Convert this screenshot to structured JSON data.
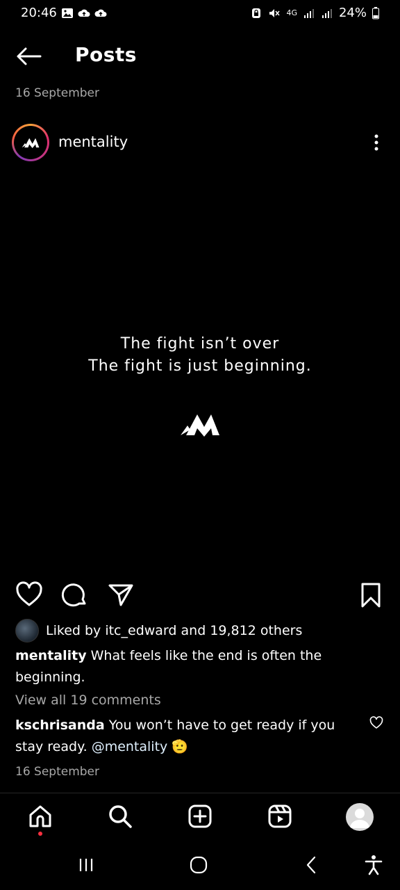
{
  "status_bar": {
    "time": "20:46",
    "network": "4G",
    "battery": "24%"
  },
  "header": {
    "title": "Posts"
  },
  "post": {
    "date_top": "16 September",
    "username": "mentality",
    "quote_line1": "The fight isn’t over",
    "quote_line2": "The fight is just beginning.",
    "likes_prefix": "Liked by ",
    "liked_by_user": "itc_edward",
    "likes_mid": " and ",
    "likes_count": "19,812 others",
    "caption_user": "mentality",
    "caption_text": " What feels like the end is often the beginning.",
    "view_comments": "View all 19 comments",
    "comment_user": "kschrisanda",
    "comment_text": " You won’t have to get ready if you stay ready. ",
    "comment_mention": "@mentality",
    "comment_emoji": "🫡",
    "date_bottom": "16 September"
  },
  "icons": {
    "status_left": [
      "gallery-icon",
      "cloud-upload-icon",
      "cloud-upload-icon"
    ],
    "status_right": [
      "vpn-icon",
      "mute-icon",
      "signal-icon",
      "signal-icon",
      "battery-icon"
    ],
    "actions": [
      "heart-icon",
      "comment-icon",
      "share-icon",
      "bookmark-icon"
    ],
    "bottom_nav": [
      "home-icon",
      "search-icon",
      "create-icon",
      "reels-icon",
      "profile-avatar"
    ],
    "system_nav": [
      "recents-icon",
      "home-circle-icon",
      "back-chevron-icon",
      "accessibility-icon"
    ]
  },
  "colors": {
    "background": "#000000",
    "text": "#ffffff",
    "secondary_text": "#a8a8a8",
    "notification_dot": "#ff3040"
  }
}
